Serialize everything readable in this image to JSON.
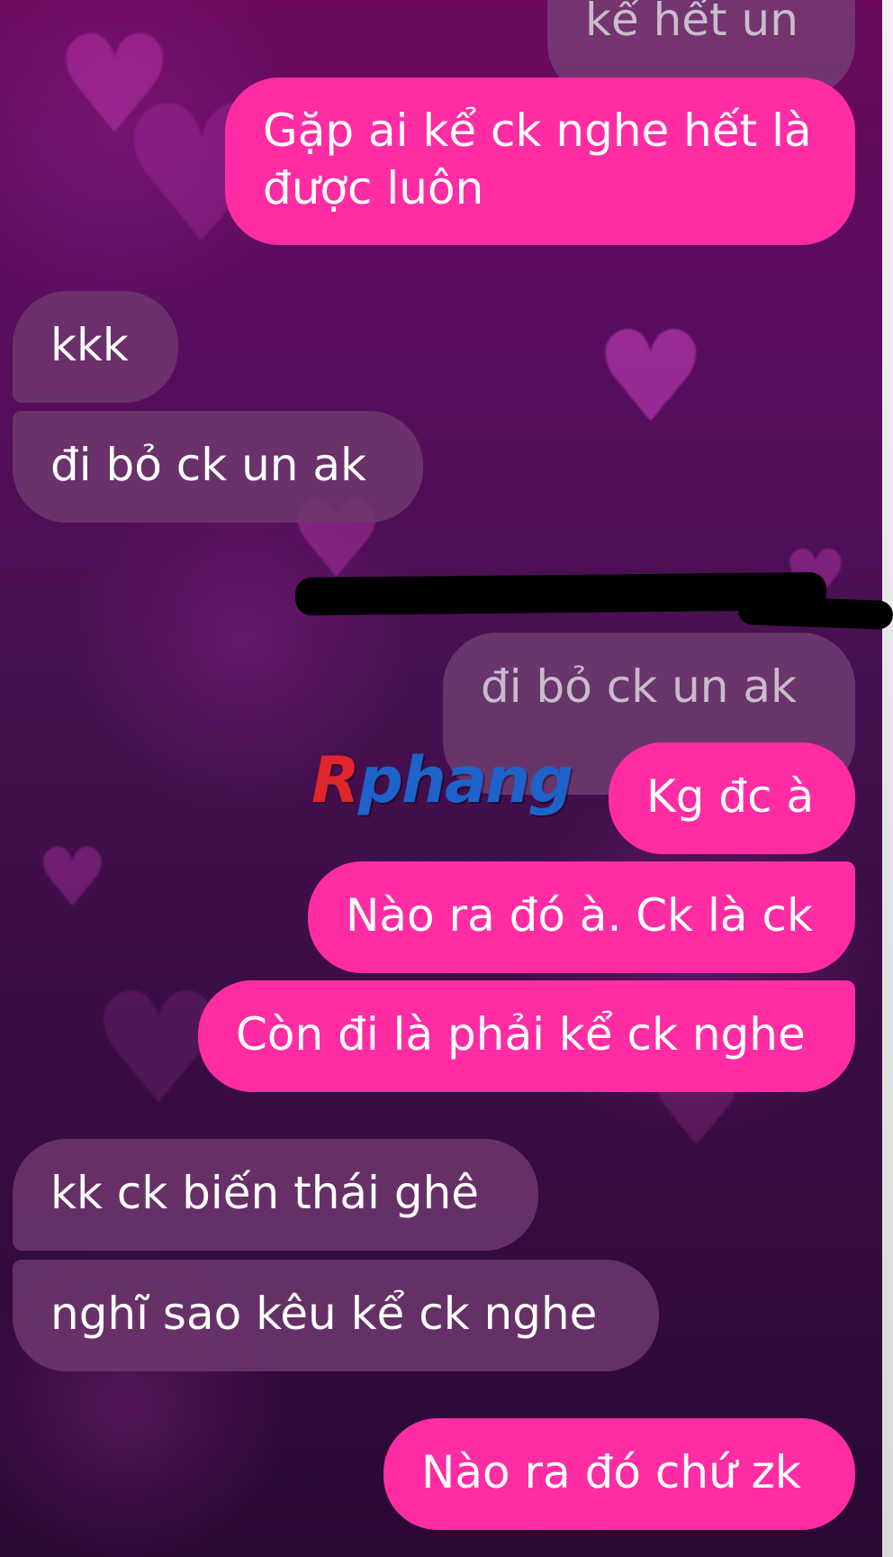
{
  "chat": {
    "messages": [
      {
        "sender": "quote",
        "text": "kể hết un"
      },
      {
        "sender": "me",
        "lines": [
          "Gặp ai kể ck nghe hết là",
          "được luôn"
        ]
      },
      {
        "sender": "them",
        "text": "kkk"
      },
      {
        "sender": "them",
        "text": "đi bỏ ck un ak"
      },
      {
        "sender": "quote",
        "text": "đi bỏ ck un ak"
      },
      {
        "sender": "me",
        "text": "Kg đc à"
      },
      {
        "sender": "me",
        "text": "Nào ra đó à. Ck là ck"
      },
      {
        "sender": "me",
        "text": "Còn đi là phải kể ck nghe"
      },
      {
        "sender": "them",
        "text": "kk ck biến thái ghê"
      },
      {
        "sender": "them",
        "text": "nghĩ sao kêu kể ck nghe"
      },
      {
        "sender": "me",
        "text": "Nào ra đó chứ zk"
      }
    ]
  },
  "watermark": {
    "first": "R",
    "rest": "phang"
  },
  "colors": {
    "my_bubble": "#ff2ca4",
    "their_bubble": "#6e376e",
    "background_top": "#6b0a5e",
    "background_bottom": "#2a0933"
  }
}
